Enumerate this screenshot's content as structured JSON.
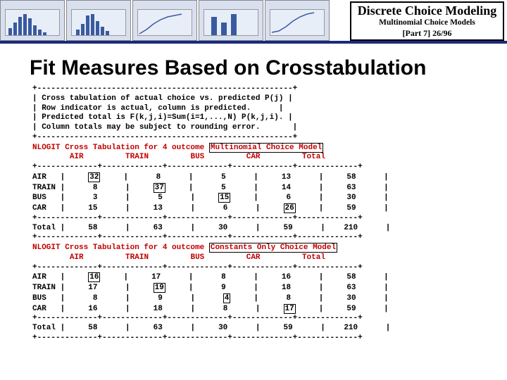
{
  "header": {
    "title": "Discrete Choice Modeling",
    "subtitle": "Multinomial Choice Models",
    "part": "[Part 7]  26/96"
  },
  "slide_title": "Fit Measures Based on Crosstabulation",
  "box": {
    "l1": "Cross tabulation of actual choice vs. predicted P(j)",
    "l2": "Row indicator is actual, column is predicted.",
    "l3": "Predicted total is F(k,j,i)=Sum(i=1,...,N) P(k,j,i).",
    "l4": "Column totals may be subject to rounding error."
  },
  "nlogit1_title_a": "NLOGIT Cross Tabulation for 4 outcome ",
  "nlogit1_title_b": "Multinomial Choice Model",
  "nlogit2_title_a": "NLOGIT Cross Tabulation for 4 outcome ",
  "nlogit2_title_b": "Constants Only Choice Model",
  "hdr": {
    "c1": "AIR",
    "c2": "TRAIN",
    "c3": "BUS",
    "c4": "CAR",
    "c5": "Total"
  },
  "rows": {
    "r1": "AIR",
    "r2": "TRAIN",
    "r3": "BUS",
    "r4": "CAR",
    "tot": "Total"
  },
  "t1": {
    "r1": {
      "c1": "32",
      "c2": "8",
      "c3": "5",
      "c4": "13",
      "c5": "58"
    },
    "r2": {
      "c1": "8",
      "c2": "37",
      "c3": "5",
      "c4": "14",
      "c5": "63"
    },
    "r3": {
      "c1": "3",
      "c2": "5",
      "c3": "15",
      "c4": "6",
      "c5": "30"
    },
    "r4": {
      "c1": "15",
      "c2": "13",
      "c3": "6",
      "c4": "26",
      "c5": "59"
    },
    "tot": {
      "c1": "58",
      "c2": "63",
      "c3": "30",
      "c4": "59",
      "c5": "210"
    }
  },
  "t2": {
    "r1": {
      "c1": "16",
      "c2": "17",
      "c3": "8",
      "c4": "16",
      "c5": "58"
    },
    "r2": {
      "c1": "17",
      "c2": "19",
      "c3": "9",
      "c4": "18",
      "c5": "63"
    },
    "r3": {
      "c1": "8",
      "c2": "9",
      "c3": "4",
      "c4": "8",
      "c5": "30"
    },
    "r4": {
      "c1": "16",
      "c2": "18",
      "c3": "8",
      "c4": "17",
      "c5": "59"
    },
    "tot": {
      "c1": "58",
      "c2": "63",
      "c3": "30",
      "c4": "59",
      "c5": "210"
    }
  }
}
